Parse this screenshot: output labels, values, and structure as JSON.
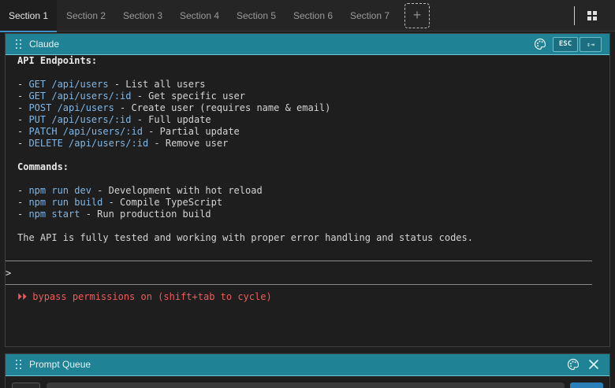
{
  "tabs": [
    {
      "label": "Section 1",
      "active": true
    },
    {
      "label": "Section 2"
    },
    {
      "label": "Section 3"
    },
    {
      "label": "Section 4"
    },
    {
      "label": "Section 5"
    },
    {
      "label": "Section 6"
    },
    {
      "label": "Section 7"
    }
  ],
  "tabbar": {
    "add_label": "+",
    "layout_icon": "grid-icon"
  },
  "panel": {
    "title": "Claude",
    "esc_label": "ESC",
    "expand_label": "⇕⇥",
    "icons": [
      "drag-handle-icon",
      "palette-icon"
    ]
  },
  "terminal": {
    "heading_endpoints": "API Endpoints:",
    "endpoints": [
      {
        "prefix": "- ",
        "route": "GET /api/users",
        "desc": " - List all users"
      },
      {
        "prefix": "- ",
        "route": "GET /api/users/:id",
        "desc": " - Get specific user"
      },
      {
        "prefix": "- ",
        "route": "POST /api/users",
        "desc": " - Create user (requires name & email)"
      },
      {
        "prefix": "- ",
        "route": "PUT /api/users/:id",
        "desc": " - Full update"
      },
      {
        "prefix": "- ",
        "route": "PATCH /api/users/:id",
        "desc": " - Partial update"
      },
      {
        "prefix": "- ",
        "route": "DELETE /api/users/:id",
        "desc": " - Remove user"
      }
    ],
    "heading_commands": "Commands:",
    "commands": [
      {
        "prefix": "- ",
        "cmd": "npm run dev",
        "desc": " - Development with hot reload"
      },
      {
        "prefix": "- ",
        "cmd": "npm run build",
        "desc": " - Compile TypeScript"
      },
      {
        "prefix": "- ",
        "cmd": "npm start",
        "desc": " - Run production build"
      }
    ],
    "summary": "The API is fully tested and working with proper error handling and status codes.",
    "prompt_char": ">",
    "status_glyph": "⏵⏵",
    "status": " bypass permissions on (shift+tab to cycle)",
    "accent_color": "#1f8295",
    "warn_color": "#f05a5a",
    "code_color": "#7fb6e6"
  },
  "queue": {
    "title": "Prompt Queue",
    "icons": [
      "drag-handle-icon",
      "palette-icon",
      "close-icon"
    ]
  }
}
